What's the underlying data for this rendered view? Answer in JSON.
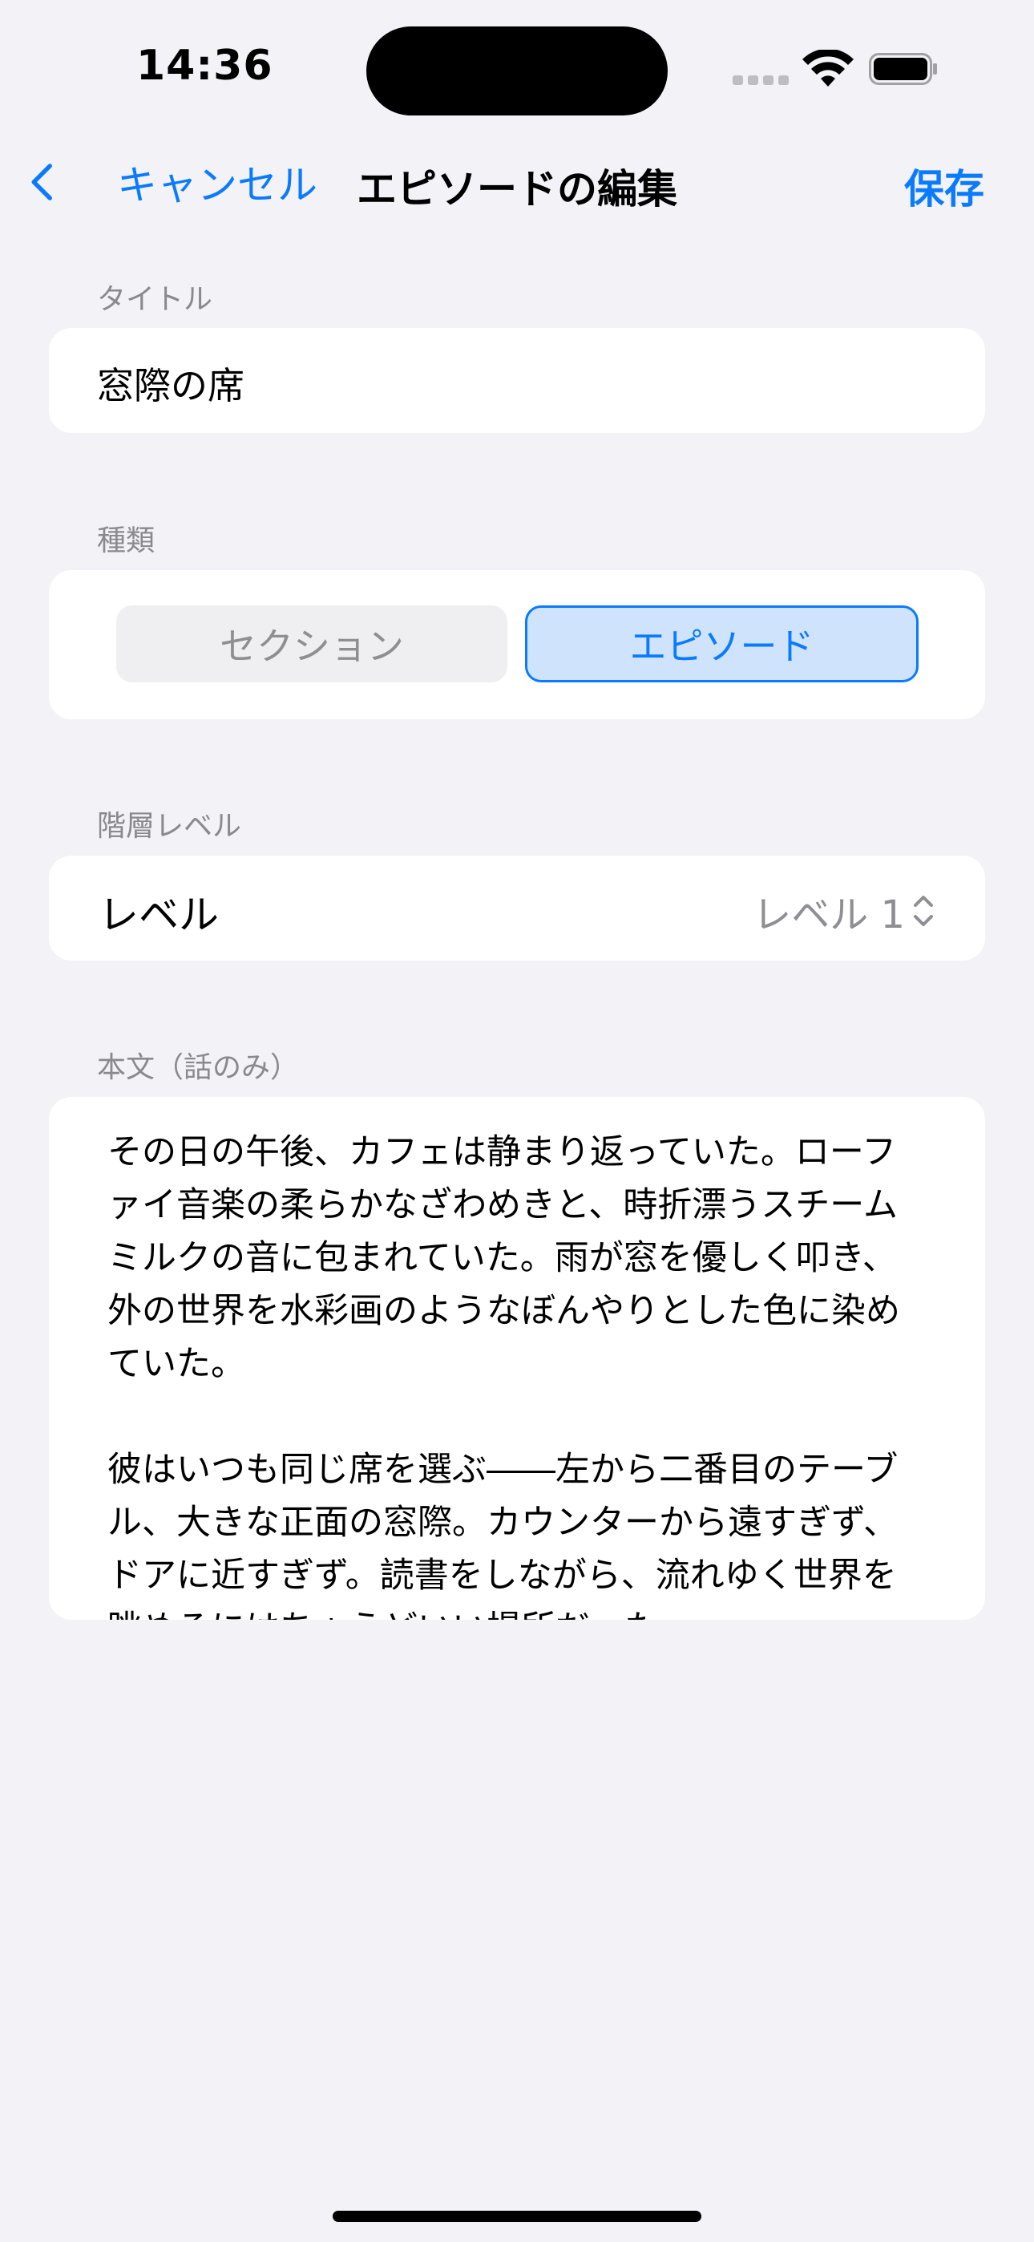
{
  "status_bar": {
    "time": "14:36"
  },
  "nav": {
    "cancel_label": "キャンセル",
    "title": "エピソードの編集",
    "save_label": "保存"
  },
  "title_section": {
    "label": "タイトル",
    "value": "窓際の席"
  },
  "type_section": {
    "label": "種類",
    "options": [
      "セクション",
      "エピソード"
    ],
    "selected": "エピソード"
  },
  "level_section": {
    "label": "階層レベル",
    "row_label": "レベル",
    "value": "レベル 1"
  },
  "body_section": {
    "label": "本文（話のみ）",
    "text": "その日の午後、カフェは静まり返っていた。ローファイ音楽の柔らかなざわめきと、時折漂うスチームミルクの音に包まれていた。雨が窓を優しく叩き、外の世界を水彩画のようなぼんやりとした色に染めていた。\n\n彼はいつも同じ席を選ぶ――左から二番目のテーブル、大きな正面の窓際。カウンターから遠すぎず、ドアに近すぎず。読書をしながら、流れゆく世界を眺めるにはちょうどいい場所だった。"
  },
  "colors": {
    "accent": "#0A7AFF",
    "background": "#F2F2F7",
    "card": "#FFFFFF",
    "secondary_text": "#8E8E93",
    "selected_segment_fill": "#CFE4FC"
  }
}
